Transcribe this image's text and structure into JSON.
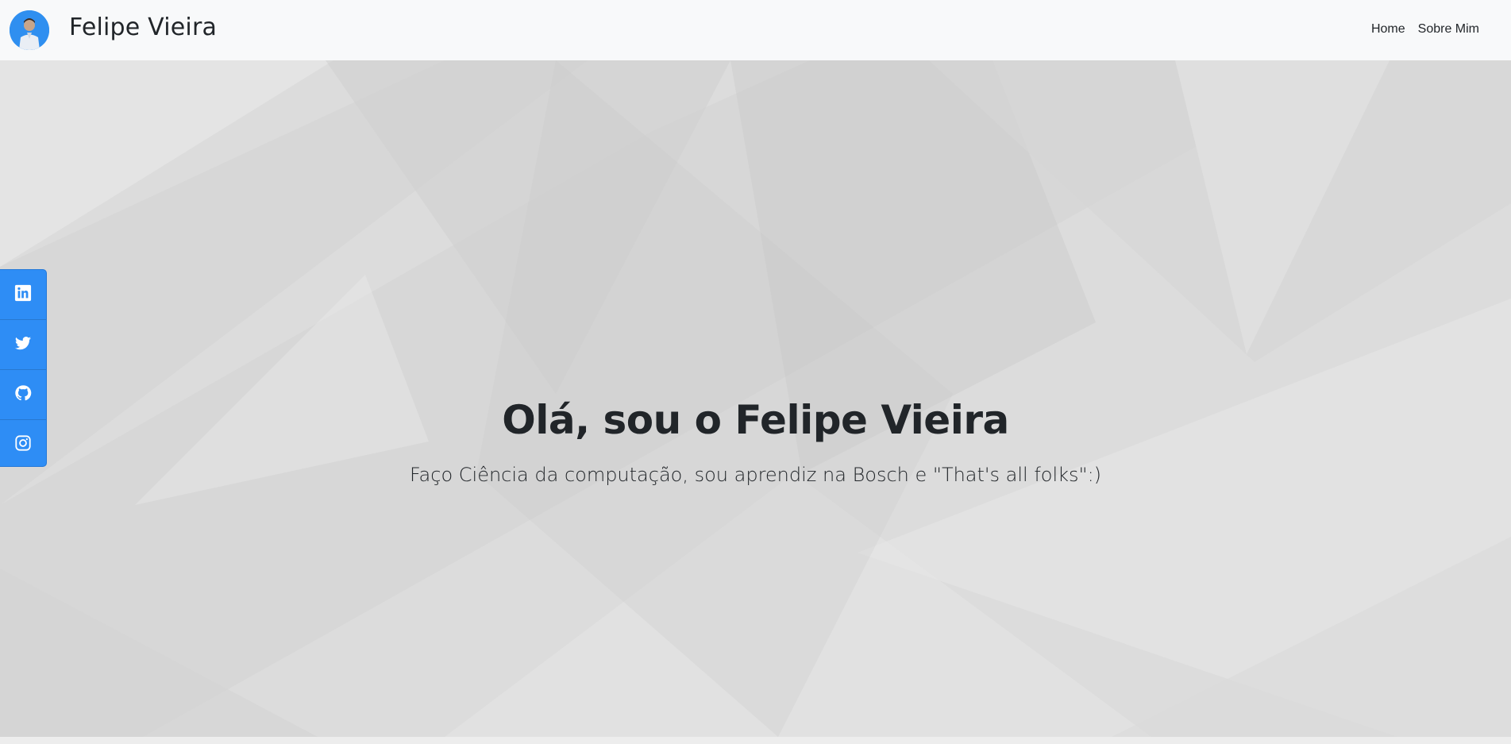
{
  "navbar": {
    "brand": "Felipe Vieira",
    "links": [
      "Home",
      "Sobre Mim"
    ]
  },
  "hero": {
    "title": "Olá, sou o Felipe Vieira",
    "subtitle": "Faço Ciência da computação, sou aprendiz na Bosch e \"That's all folks\":)"
  },
  "social": {
    "items": [
      "linkedin-icon",
      "twitter-icon",
      "github-icon",
      "instagram-icon"
    ]
  },
  "colors": {
    "accent": "#2e8df5",
    "navbar_bg": "#f8f9fa",
    "text": "#212529"
  }
}
